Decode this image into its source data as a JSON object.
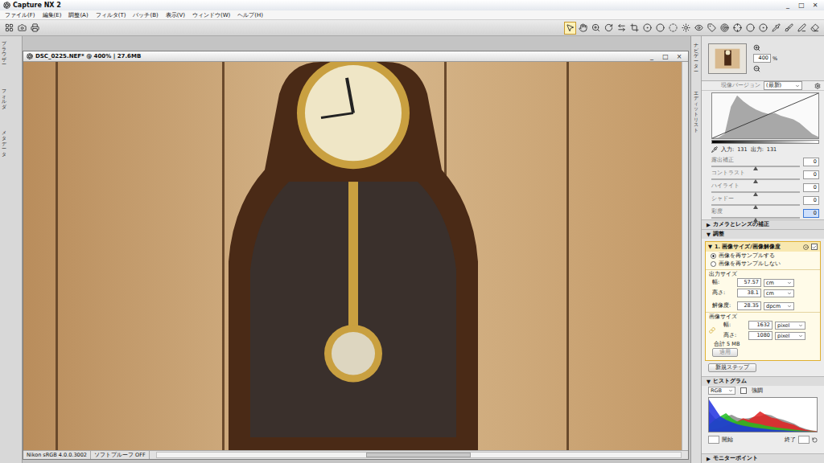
{
  "window": {
    "title": "Capture NX 2",
    "controls": [
      "_",
      "□",
      "✕"
    ]
  },
  "menu": [
    "ファイル(F)",
    "編集(E)",
    "調整(A)",
    "フィルタ(T)",
    "バッチ(B)",
    "表示(V)",
    "ウィンドウ(W)",
    "ヘルプ(H)"
  ],
  "toolbar": {
    "left": [
      {
        "selected": false
      },
      {
        "selected": false
      },
      {
        "selected": false
      }
    ],
    "right": [
      {
        "selected": true
      },
      {
        "selected": false
      },
      {
        "selected": false
      },
      {
        "selected": false
      },
      {
        "selected": false
      },
      {
        "selected": false
      },
      {
        "selected": false
      },
      {
        "selected": false
      },
      {
        "selected": false
      },
      {
        "selected": false
      },
      {
        "selected": false
      },
      {
        "selected": false
      },
      {
        "selected": false
      },
      {
        "selected": false
      },
      {
        "selected": false
      },
      {
        "selected": false
      },
      {
        "selected": false
      },
      {
        "selected": false
      },
      {
        "selected": false
      },
      {
        "selected": false
      }
    ]
  },
  "left_dock": {
    "tabs": [
      "ブラウザー",
      "フォルダ",
      "メタデータ"
    ]
  },
  "image_window": {
    "title": "DSC_0225.NEF* @ 400% | 27.6MB",
    "controls": [
      "_",
      "□",
      "×"
    ],
    "profile": "Nikon sRGB 4.0.0.3002",
    "softproof": "ソフトプルーフ OFF"
  },
  "right_dock": {
    "tabs": [
      "ナビゲーター",
      "エディットリスト"
    ]
  },
  "navigator": {
    "zoom": "400",
    "unit": "%"
  },
  "edit_list": {
    "version_label": "現像バージョン",
    "version": "(最新)",
    "curve": {
      "luminance": [
        0,
        2,
        10,
        70,
        95,
        82,
        72,
        64,
        58,
        54,
        56,
        50,
        46,
        42,
        34,
        22,
        10,
        3
      ]
    },
    "input_label": "入力:",
    "input": "131",
    "output_label": "出力:",
    "output": "131",
    "sliders": [
      {
        "label": "露出補正",
        "value": "0",
        "level": 0.5,
        "focused": false
      },
      {
        "label": "コントラスト",
        "value": "0",
        "level": 0.5,
        "focused": false
      },
      {
        "label": "ハイライト",
        "value": "0",
        "level": 0.5,
        "focused": false
      },
      {
        "label": "シャドー",
        "value": "0",
        "level": 0.5,
        "focused": false
      },
      {
        "label": "彩度",
        "value": "0",
        "level": 0.5,
        "focused": true
      }
    ]
  },
  "camera_lens": {
    "arrow": "▶",
    "label": "カメラとレンズの補正",
    "expanded": false
  },
  "adjust": {
    "arrow": "▼",
    "label": "調整",
    "expanded": true
  },
  "step": {
    "arrow": "▼",
    "title": "1. 画像サイズ/画像解像度",
    "enabled": true,
    "resample": [
      {
        "label": "画像を再サンプルする",
        "selected": true
      },
      {
        "label": "画像を再サンプルしない",
        "selected": false
      }
    ],
    "output_size": {
      "label": "出力サイズ",
      "fields": [
        {
          "label": "幅:",
          "value": "57.57",
          "unit": "cm"
        },
        {
          "label": "高さ:",
          "value": "38.1",
          "unit": "cm"
        },
        {
          "label": "解像度:",
          "value": "28.35",
          "unit": "dpcm"
        }
      ]
    },
    "image_size": {
      "label": "画像サイズ",
      "linked": true,
      "fields": [
        {
          "label": "幅:",
          "value": "1632",
          "unit": "pixel"
        },
        {
          "label": "高さ:",
          "value": "1080",
          "unit": "pixel"
        }
      ]
    },
    "total": "合計 5 MB",
    "apply": {
      "label": "適用",
      "disabled": true
    }
  },
  "new_step": "新規ステップ",
  "histogram": {
    "arrow": "▼",
    "title": "ヒストグラム",
    "channel": "RGB",
    "emphasis": {
      "label": "強調",
      "checked": false
    },
    "series": [
      {
        "name": "luminance",
        "color": "#8a8a8a",
        "values": [
          60,
          40,
          30,
          45,
          50,
          42,
          38,
          40,
          44,
          46,
          52,
          48,
          40,
          36,
          30,
          24,
          14,
          8,
          4,
          2
        ]
      },
      {
        "name": "red",
        "color": "#e02020",
        "values": [
          5,
          8,
          12,
          18,
          25,
          30,
          40,
          35,
          45,
          60,
          50,
          42,
          38,
          30,
          25,
          20,
          12,
          6,
          3,
          1
        ]
      },
      {
        "name": "green",
        "color": "#20c020",
        "values": [
          20,
          35,
          45,
          55,
          40,
          30,
          35,
          28,
          25,
          22,
          18,
          15,
          12,
          10,
          8,
          6,
          4,
          2,
          1,
          0
        ]
      },
      {
        "name": "blue",
        "color": "#2030e0",
        "values": [
          95,
          70,
          45,
          35,
          28,
          22,
          18,
          15,
          12,
          10,
          8,
          6,
          5,
          4,
          3,
          2,
          1,
          1,
          0,
          0
        ]
      }
    ],
    "start_label": "開始",
    "end_label": "終了"
  },
  "monitor": {
    "arrow": "▶",
    "label": "モニターポイント",
    "expanded": false
  }
}
